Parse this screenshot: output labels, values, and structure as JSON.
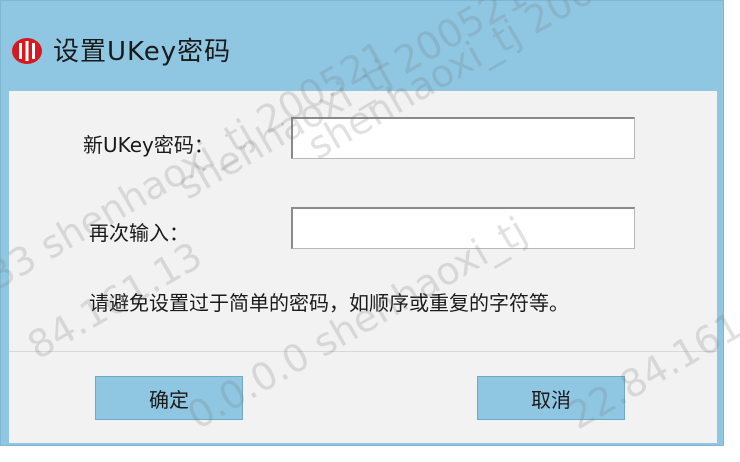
{
  "dialog": {
    "title": "设置UKey密码",
    "logo_icon": "ukey-logo-icon",
    "accent_color": "#8fc7e2",
    "logo_color": "#d6191f"
  },
  "form": {
    "new_password_label": "新UKey密码：",
    "new_password_value": "",
    "confirm_password_label": "再次输入：",
    "confirm_password_value": "",
    "hint": "请避免设置过于简单的密码，如顺序或重复的字符等。"
  },
  "buttons": {
    "ok_label": "确定",
    "cancel_label": "取消"
  },
  "watermark": {
    "lines": [
      "shenhaoxi_tj 200521",
      "shenhaoxi_tj 200521",
      "33 shenhaoxi_tj 200521",
      "84.161.13",
      "0.0.0.0 shenhaoxi_tj",
      "22.84.161"
    ]
  }
}
